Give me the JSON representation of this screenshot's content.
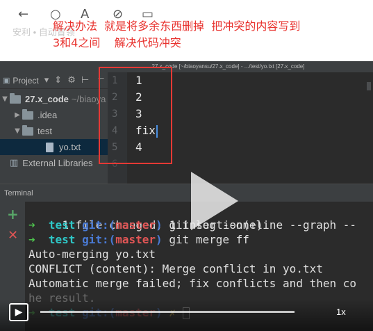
{
  "annotation": {
    "line1": "解决办法  就是将多余东西删掉  把冲突的内容写到",
    "line2": "3和4之间    解决代码冲突"
  },
  "topbar": {
    "faded_text": "安利 • 自动冒领",
    "icons": [
      "back-arrow-icon",
      "refresh-icon",
      "text-icon",
      "link-icon",
      "window-icon"
    ]
  },
  "window": {
    "title": "27.x_code [~/biaoyansu/27.x_code] - .../test/yo.txt [27.x_code]"
  },
  "project": {
    "toolbar_title": "Project",
    "root_name": "27.x_code",
    "root_path": "~/biaoya",
    "items": [
      {
        "label": ".idea"
      },
      {
        "label": "test"
      },
      {
        "label": "yo.txt"
      },
      {
        "label": "External Libraries"
      }
    ]
  },
  "editor": {
    "lines": [
      {
        "num": "1",
        "text": "1"
      },
      {
        "num": "2",
        "text": "2"
      },
      {
        "num": "3",
        "text": "3"
      },
      {
        "num": "4",
        "text": "fix"
      },
      {
        "num": "5",
        "text": "4"
      },
      {
        "num": "6",
        "text": ""
      }
    ]
  },
  "terminal": {
    "tab_label": "Terminal",
    "line_changed": "1 file changed, 1 insertion(+)",
    "prompt_arrow": "➜",
    "repo": "test",
    "git_label": "git:(",
    "branch": "master",
    "git_close": ")",
    "cmd1": " git log --oneline --graph --",
    "cmd2": " git merge ff",
    "out1": "Auto-merging yo.txt",
    "out2": "CONFLICT (content): Merge conflict in yo.txt",
    "out3": "Automatic merge failed; fix conflicts and then co",
    "out4": "he result.",
    "dirty_mark": " ✗ "
  },
  "player": {
    "speed": "1x",
    "progress_fraction": 0.0
  }
}
